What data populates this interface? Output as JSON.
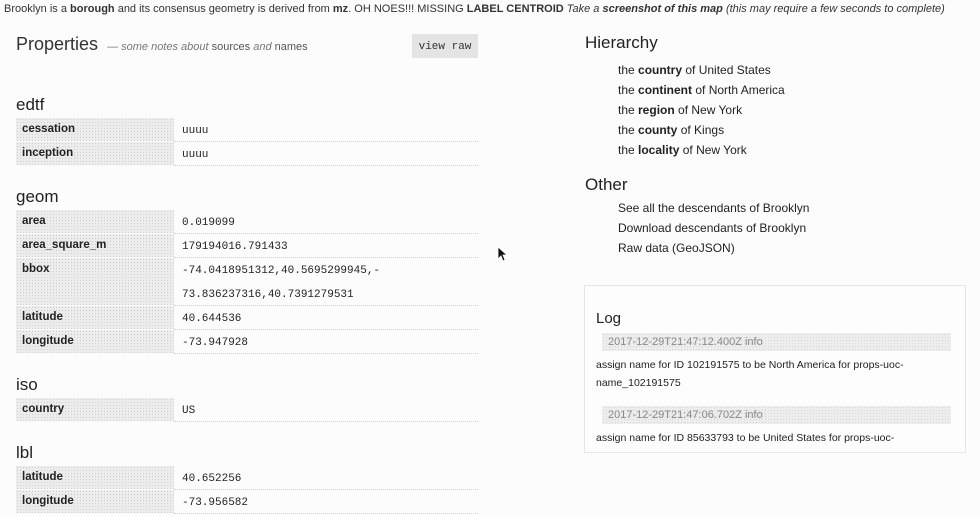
{
  "topbar": {
    "place": "Brooklyn",
    "is_a": " is a ",
    "placetype": "borough",
    "geom_mid": " and its consensus geometry is derived from ",
    "source": "mz",
    "warn": ". OH NOES!!! MISSING ",
    "warn_bold": "LABEL CENTROID",
    "take": " Take a ",
    "screenshot": "screenshot of this map",
    "note": " (this may require a few seconds to complete)"
  },
  "properties": {
    "title": "Properties",
    "note_dash": "— some notes about ",
    "note_sources": "sources",
    "note_and": " and ",
    "note_names": "names",
    "view_raw": "view raw"
  },
  "sections": {
    "edtf": {
      "title": "edtf",
      "rows": [
        {
          "key": "cessation",
          "value": "uuuu"
        },
        {
          "key": "inception",
          "value": "uuuu"
        }
      ]
    },
    "geom": {
      "title": "geom",
      "rows": [
        {
          "key": "area",
          "value": "0.019099"
        },
        {
          "key": "area_square_m",
          "value": "179194016.791433"
        },
        {
          "key": "bbox",
          "value_line1": "-74.0418951312,40.5695299945,-",
          "value_line2": "73.836237316,40.7391279531"
        },
        {
          "key": "latitude",
          "value": "40.644536"
        },
        {
          "key": "longitude",
          "value": "-73.947928"
        }
      ]
    },
    "iso": {
      "title": "iso",
      "rows": [
        {
          "key": "country",
          "value": "US"
        }
      ]
    },
    "lbl": {
      "title": "lbl",
      "rows": [
        {
          "key": "latitude",
          "value": "40.652256"
        },
        {
          "key": "longitude",
          "value": "-73.956582"
        }
      ]
    }
  },
  "hierarchy": {
    "title": "Hierarchy",
    "items": [
      {
        "pre": "the ",
        "type": "country",
        "of": " of ",
        "name": "United States"
      },
      {
        "pre": "the ",
        "type": "continent",
        "of": " of ",
        "name": "North America"
      },
      {
        "pre": "the ",
        "type": "region",
        "of": " of ",
        "name": "New York"
      },
      {
        "pre": "the ",
        "type": "county",
        "of": " of ",
        "name": "Kings"
      },
      {
        "pre": "the ",
        "type": "locality",
        "of": " of ",
        "name": "New York"
      }
    ]
  },
  "other": {
    "title": "Other",
    "items": [
      "See all the descendants of Brooklyn",
      "Download descendants of Brooklyn",
      "Raw data (GeoJSON)"
    ]
  },
  "log": {
    "title": "Log",
    "entries": [
      {
        "ts": "2017-12-29T21:47:12.400Z info",
        "msg_line1": "assign name for ID 102191575 to be North America for props-uoc-",
        "msg_line2": "name_102191575"
      },
      {
        "ts": "2017-12-29T21:47:06.702Z info",
        "msg_line1": "assign name for ID 85633793 to be United States for props-uoc-"
      }
    ]
  }
}
